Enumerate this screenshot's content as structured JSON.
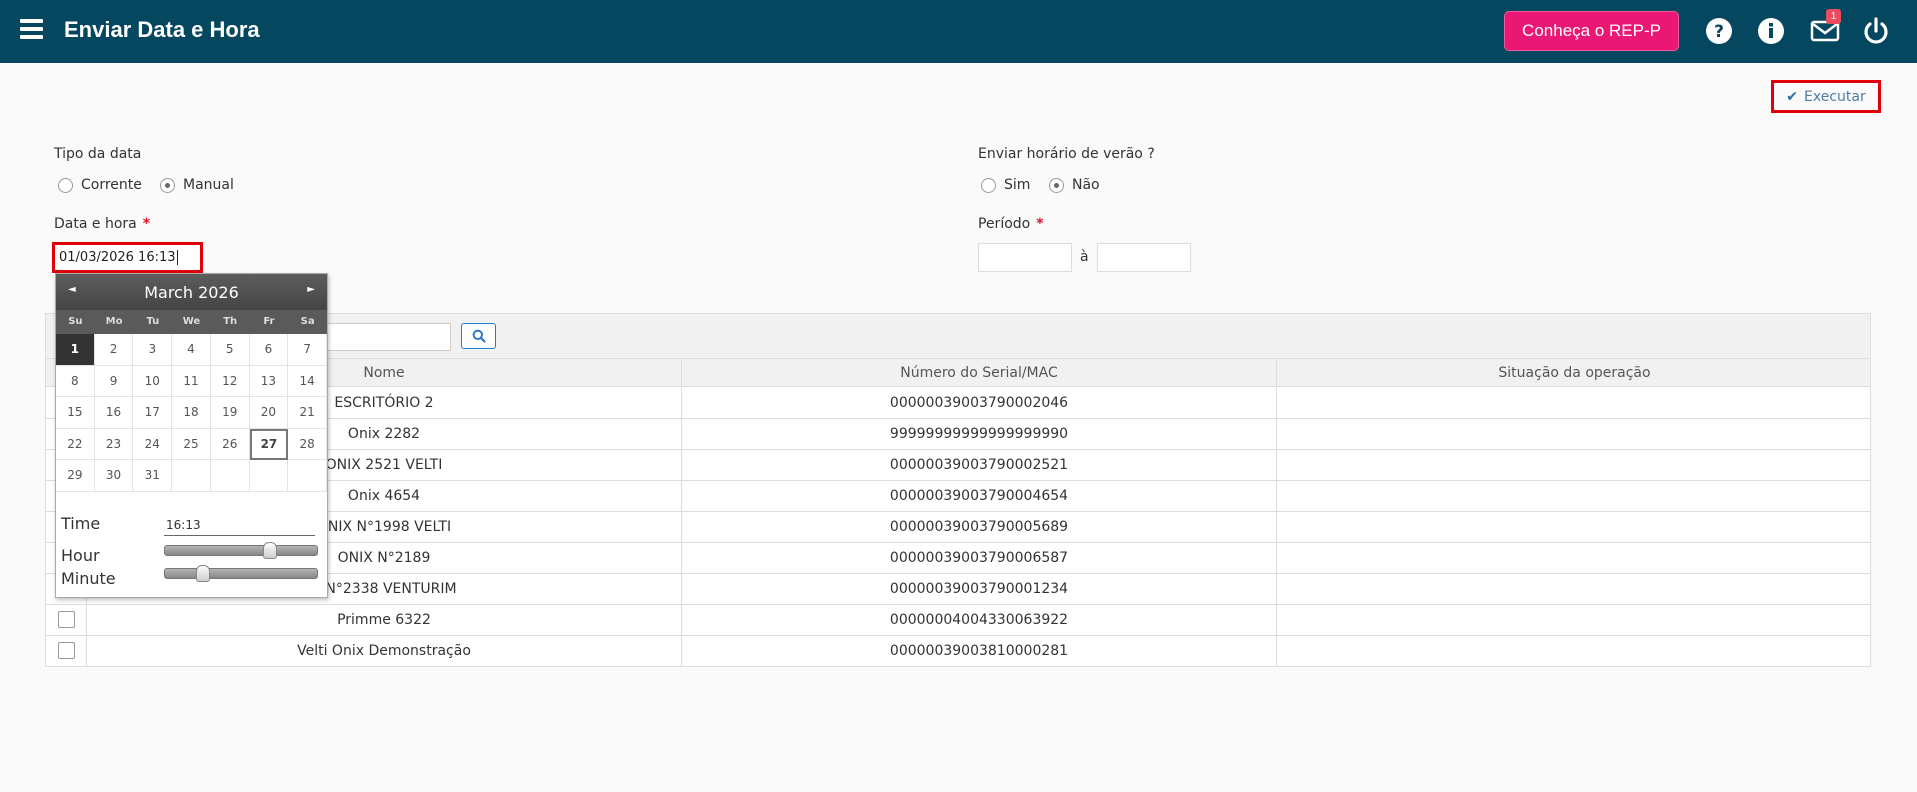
{
  "header": {
    "title": "Enviar Data e Hora",
    "rep_button": "Conheça o REP-P",
    "mail_badge": "1",
    "bg_color": "#04475f",
    "accent_color": "#ea1774"
  },
  "toolbar": {
    "execute_label": "Executar"
  },
  "form": {
    "date_type": {
      "label": "Tipo da data",
      "options": [
        {
          "label": "Corrente",
          "selected": false
        },
        {
          "label": "Manual",
          "selected": true
        }
      ]
    },
    "datetime": {
      "label": "Data e hora",
      "required_mark": "*",
      "value": "01/03/2026 16:13"
    },
    "dst": {
      "label": "Enviar horário de verão ?",
      "options": [
        {
          "label": "Sim",
          "selected": false
        },
        {
          "label": "Não",
          "selected": true
        }
      ]
    },
    "period": {
      "label": "Período",
      "required_mark": "*",
      "separator": "à",
      "start": "",
      "end": ""
    }
  },
  "datepicker": {
    "month_label": "March 2026",
    "weekdays": [
      "Su",
      "Mo",
      "Tu",
      "We",
      "Th",
      "Fr",
      "Sa"
    ],
    "days": [
      "1",
      "2",
      "3",
      "4",
      "5",
      "6",
      "7",
      "8",
      "9",
      "10",
      "11",
      "12",
      "13",
      "14",
      "15",
      "16",
      "17",
      "18",
      "19",
      "20",
      "21",
      "22",
      "23",
      "24",
      "25",
      "26",
      "27",
      "28",
      "29",
      "30",
      "31"
    ],
    "selected_day": "1",
    "today_day": "27",
    "time_label": "Time",
    "time_value": "16:13",
    "hour_label": "Hour",
    "minute_label": "Minute",
    "hour_fraction": 0.7,
    "minute_fraction": 0.22
  },
  "table": {
    "columns": [
      "Nome",
      "Número do Serial/MAC",
      "Situação da operação"
    ],
    "rows": [
      {
        "name": "ESCRITÓRIO 2",
        "serial": "00000039003790002046",
        "status": ""
      },
      {
        "name": "Onix 2282",
        "serial": "99999999999999999990",
        "status": ""
      },
      {
        "name": "ONIX 2521 VELTI",
        "serial": "00000039003790002521",
        "status": ""
      },
      {
        "name": "Onix 4654",
        "serial": "00000039003790004654",
        "status": ""
      },
      {
        "name": "ONIX N°1998 VELTI",
        "serial": "00000039003790005689",
        "status": ""
      },
      {
        "name": "ONIX N°2189",
        "serial": "00000039003790006587",
        "status": ""
      },
      {
        "name": "X N°2338 VENTURIM",
        "serial": "00000039003790001234",
        "status": ""
      },
      {
        "name": "Primme 6322",
        "serial": "00000004004330063922",
        "status": ""
      },
      {
        "name": "Velti Onix Demonstração",
        "serial": "00000039003810000281",
        "status": ""
      }
    ]
  }
}
